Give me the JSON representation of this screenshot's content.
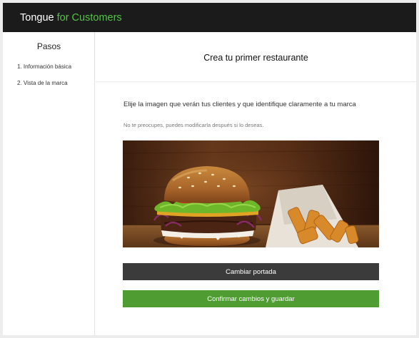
{
  "app": {
    "brand_main": "Tongue",
    "brand_accent": "for Customers",
    "accent_color": "#55c34a"
  },
  "sidebar": {
    "title": "Pasos",
    "steps": [
      {
        "label": "1. Información básica"
      },
      {
        "label": "2. Vista de la marca"
      }
    ]
  },
  "main": {
    "title": "Crea tu primer restaurante",
    "instruction": "Elije la imagen que verán tus clientes y que identifique claramente a tu marca",
    "note": "No te preocupes, puedes modificarla después si lo deseas.",
    "cover_image": "burger-with-fries-photo",
    "change_cover_label": "Cambiar portada",
    "confirm_label": "Confirmar cambios y guardar",
    "confirm_color": "#4f9c33",
    "change_color": "#3b3b3b"
  }
}
